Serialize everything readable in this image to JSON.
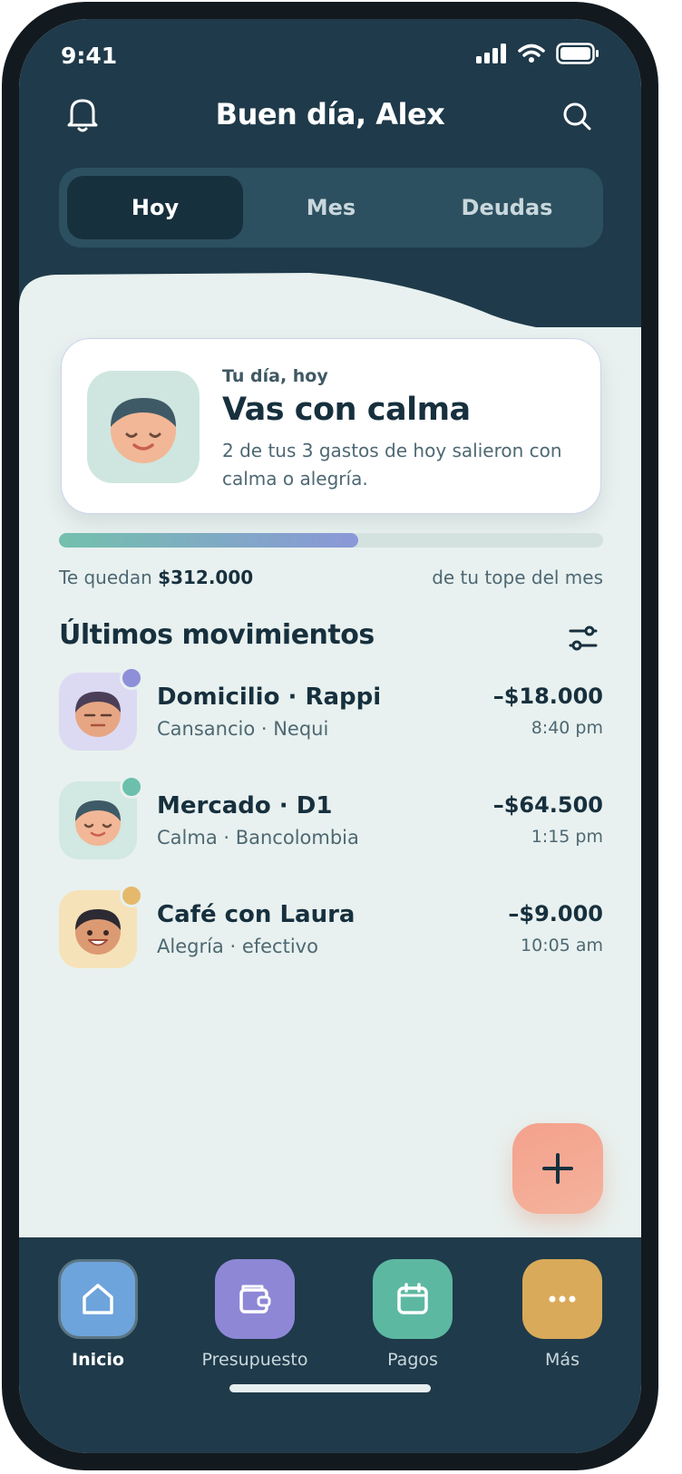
{
  "status_bar": {
    "time": "9:41"
  },
  "header": {
    "greeting": "Buen día, Alex"
  },
  "segments": [
    {
      "label": "Hoy",
      "active": true
    },
    {
      "label": "Mes",
      "active": false
    },
    {
      "label": "Deudas",
      "active": false
    }
  ],
  "mood_card": {
    "kicker": "Tu día, hoy",
    "title": "Vas con calma",
    "description": "2 de tus 3 gastos de hoy salieron con calma o alegría."
  },
  "budget": {
    "prefix": "Te quedan",
    "amount": "$312.000",
    "suffix": "de tu tope del mes",
    "progress_fraction": 0.55
  },
  "movements": {
    "title": "Últimos movimientos",
    "items": [
      {
        "name": "Domicilio · Rappi",
        "subtitle": "Cansancio · Nequi",
        "amount": "–$18.000",
        "time": "8:40 pm",
        "mood": "tired",
        "color": "#8d8fd9",
        "bg": "#dcdaf3"
      },
      {
        "name": "Mercado · D1",
        "subtitle": "Calma · Bancolombia",
        "amount": "–$64.500",
        "time": "1:15 pm",
        "mood": "calm",
        "color": "#6cc0ab",
        "bg": "#d2e8e2"
      },
      {
        "name": "Café con Laura",
        "subtitle": "Alegría · efectivo",
        "amount": "–$9.000",
        "time": "10:05 am",
        "mood": "happy",
        "color": "#e5b96b",
        "bg": "#f6e2b8"
      }
    ]
  },
  "tabbar": [
    {
      "label": "Inicio",
      "icon": "home-icon",
      "color": "#6ea4dc",
      "active": true
    },
    {
      "label": "Presupuesto",
      "icon": "wallet-icon",
      "color": "#8e87d6",
      "active": false
    },
    {
      "label": "Pagos",
      "icon": "calendar-icon",
      "color": "#5db8a2",
      "active": false
    },
    {
      "label": "Más",
      "icon": "more-icon",
      "color": "#d9aa5a",
      "active": false
    }
  ]
}
